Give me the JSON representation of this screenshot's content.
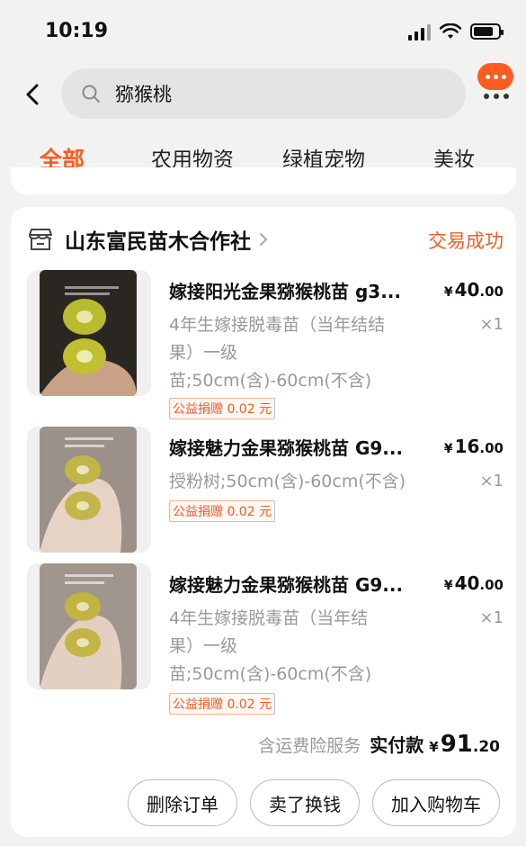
{
  "status_bar": {
    "time": "10:19",
    "battery_level": 0.8
  },
  "search": {
    "query": "猕猴桃"
  },
  "tabs": [
    {
      "label": "全部",
      "active": true
    },
    {
      "label": "农用物资",
      "active": false
    },
    {
      "label": "绿植宠物",
      "active": false
    },
    {
      "label": "美妆",
      "active": false
    }
  ],
  "order": {
    "shop_name": "山东富民苗木合作社",
    "status": "交易成功",
    "items": [
      {
        "title": "嫁接阳光金果猕猴桃苗 g3...",
        "spec_lines": [
          "4年生嫁接脱毒苗（当年结结",
          "果）一级",
          "苗;50cm(含)-60cm(不含)"
        ],
        "price_yen": "¥",
        "price_int": "40",
        "price_cents": ".00",
        "qty": "×1",
        "charity": "公益捐赠 0.02 元"
      },
      {
        "title": "嫁接魅力金果猕猴桃苗 G9...",
        "spec_lines": [
          "授粉树;50cm(含)-60cm(不含)"
        ],
        "price_yen": "¥",
        "price_int": "16",
        "price_cents": ".00",
        "qty": "×1",
        "charity": "公益捐赠 0.02 元"
      },
      {
        "title": "嫁接魅力金果猕猴桃苗 G9...",
        "spec_lines": [
          "4年生嫁接脱毒苗（当年结",
          "果）一级",
          "苗;50cm(含)-60cm(不含)"
        ],
        "price_yen": "¥",
        "price_int": "40",
        "price_cents": ".00",
        "qty": "×1",
        "charity": "公益捐赠 0.02 元"
      }
    ],
    "total_note": "含运费险服务",
    "total_label": "实付款",
    "total_yen": "¥",
    "total_int": "91",
    "total_cents": ".20",
    "actions": [
      "删除订单",
      "卖了换钱",
      "加入购物车"
    ]
  },
  "colors": {
    "accent": "#ff5a1f",
    "muted": "#999999"
  }
}
